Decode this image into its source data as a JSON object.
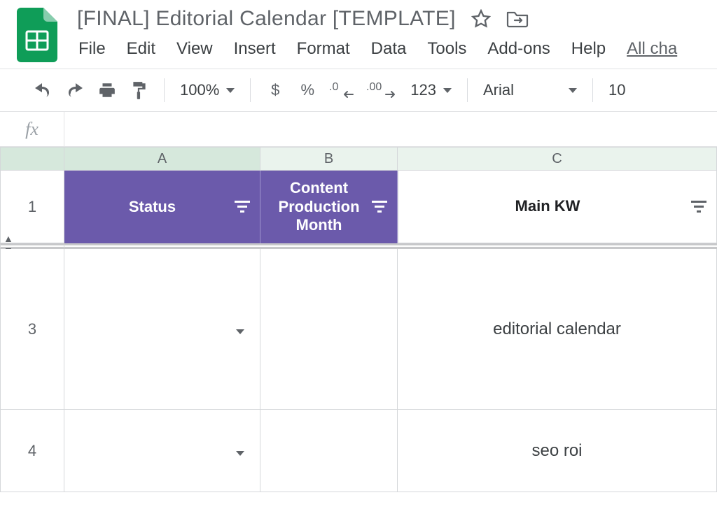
{
  "doc_title": "[FINAL] Editorial Calendar [TEMPLATE]",
  "menu": {
    "file": "File",
    "edit": "Edit",
    "view": "View",
    "insert": "Insert",
    "format": "Format",
    "data": "Data",
    "tools": "Tools",
    "addons": "Add-ons",
    "help": "Help",
    "all_changes": "All cha"
  },
  "toolbar": {
    "zoom": "100%",
    "currency": "$",
    "percent": "%",
    "dec_less": ".0",
    "dec_more": ".00",
    "format_more": "123",
    "font": "Arial",
    "font_size": "10"
  },
  "formula_bar": {
    "fx_label": "fx",
    "value": ""
  },
  "columns": {
    "A": "A",
    "B": "B",
    "C": "C"
  },
  "headers": {
    "status": "Status",
    "cpm": "Content Production Month",
    "main_kw": "Main KW"
  },
  "rows": {
    "r1": "1",
    "r3": "3",
    "r4": "4"
  },
  "data": {
    "r3": {
      "status": "",
      "cpm": "",
      "main_kw": "editorial calendar"
    },
    "r4": {
      "status": "",
      "cpm": "",
      "main_kw": "seo roi"
    }
  },
  "colors": {
    "header_purple": "#6b5aab",
    "arrow": "#e06659"
  }
}
